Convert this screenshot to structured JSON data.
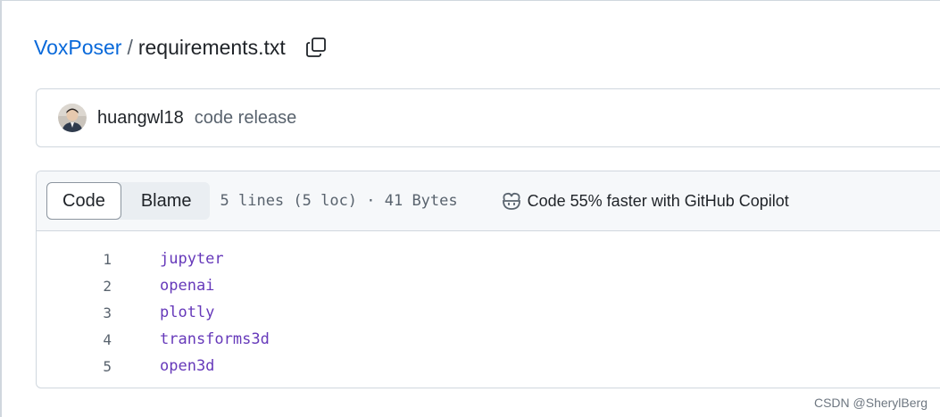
{
  "breadcrumb": {
    "repo": "VoxPoser",
    "separator": "/",
    "file": "requirements.txt"
  },
  "icons": {
    "copy": "copy-icon",
    "avatar": "avatar-image",
    "copilot": "copilot-icon"
  },
  "commit": {
    "author": "huangwl18",
    "message": "code release"
  },
  "file_header": {
    "tabs": [
      {
        "label": "Code",
        "active": true
      },
      {
        "label": "Blame",
        "active": false
      }
    ],
    "meta": "5 lines (5 loc) · 41 Bytes",
    "copilot_text": "Code 55% faster with GitHub Copilot"
  },
  "code": {
    "lines": [
      {
        "num": "1",
        "text": "jupyter"
      },
      {
        "num": "2",
        "text": "openai"
      },
      {
        "num": "3",
        "text": "plotly"
      },
      {
        "num": "4",
        "text": "transforms3d"
      },
      {
        "num": "5",
        "text": "open3d"
      }
    ]
  },
  "watermark": "CSDN @SherylBerg",
  "colors": {
    "link": "#0969da",
    "code_text": "#6639ba",
    "border": "#d0d7de",
    "header_bg": "#f6f8fa",
    "muted": "#59636e"
  }
}
